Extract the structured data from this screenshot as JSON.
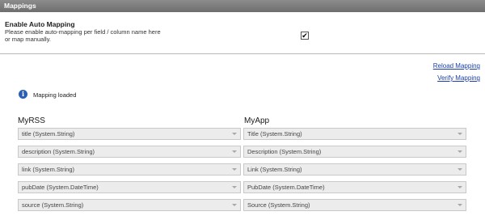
{
  "header": {
    "title": "Mappings"
  },
  "auto_mapping": {
    "title": "Enable Auto Mapping",
    "description": "Please enable auto-mapping per field / column name here or map manually.",
    "checked": true,
    "check_glyph": "✔"
  },
  "actions": {
    "reload_label": "Reload Mapping",
    "verify_label": "Verify Mapping"
  },
  "status": {
    "icon": "info-icon",
    "icon_glyph": "i",
    "message": "Mapping loaded"
  },
  "columns": {
    "source": "MyRSS",
    "target": "MyApp"
  },
  "mappings": [
    {
      "source": "title (System.String)",
      "target": "Title (System.String)"
    },
    {
      "source": "description (System.String)",
      "target": "Description (System.String)"
    },
    {
      "source": "link (System.String)",
      "target": "Link (System.String)"
    },
    {
      "source": "pubDate (System.DateTime)",
      "target": "PubDate (System.DateTime)"
    },
    {
      "source": "source (System.String)",
      "target": "Source (System.String)"
    }
  ],
  "colors": {
    "header_bg": "#7d7d7d",
    "link": "#1a3ea8",
    "info": "#2b5fb4",
    "select_bg": "#ececec"
  }
}
